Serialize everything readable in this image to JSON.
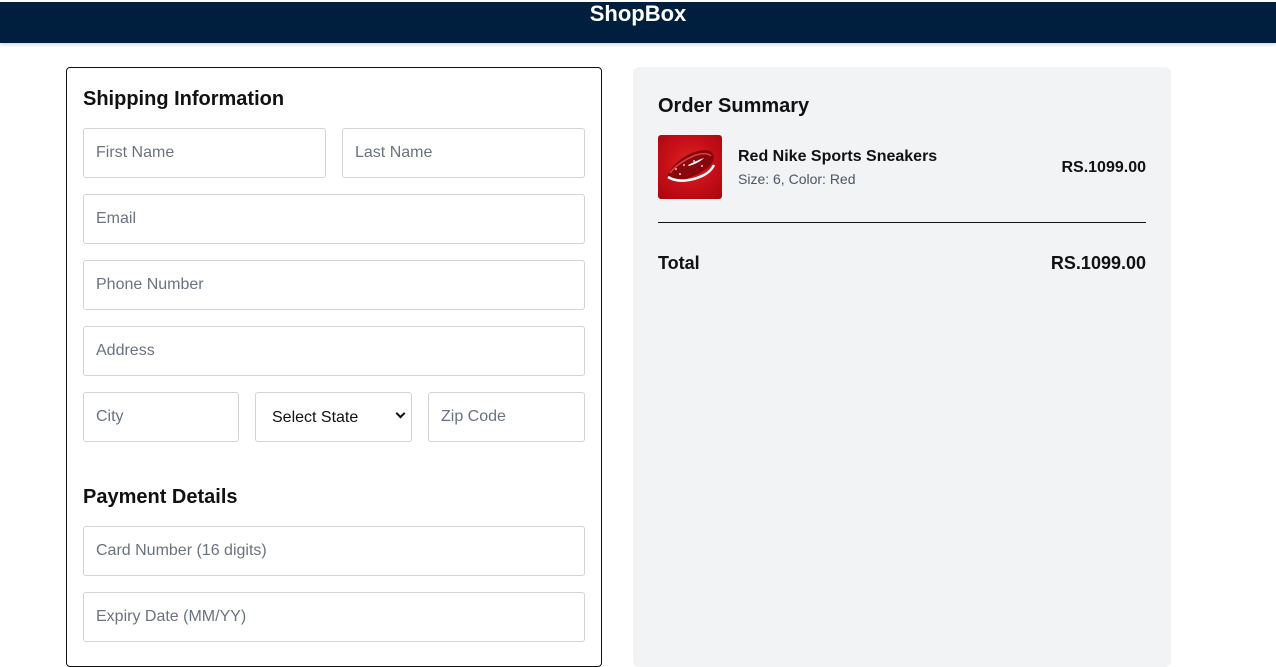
{
  "header": {
    "brand": "ShopBox"
  },
  "shipping": {
    "title": "Shipping Information",
    "first_name_placeholder": "First Name",
    "last_name_placeholder": "Last Name",
    "email_placeholder": "Email",
    "phone_placeholder": "Phone Number",
    "address_placeholder": "Address",
    "city_placeholder": "City",
    "state_selected": "Select State",
    "zip_placeholder": "Zip Code"
  },
  "payment": {
    "title": "Payment Details",
    "card_placeholder": "Card Number (16 digits)",
    "expiry_placeholder": "Expiry Date (MM/YY)"
  },
  "summary": {
    "title": "Order Summary",
    "item": {
      "name": "Red Nike Sports Sneakers",
      "meta": "Size: 6, Color: Red",
      "price": "RS.1099.00",
      "image_icon": "red-sneaker-image"
    },
    "total_label": "Total",
    "total_value": "RS.1099.00"
  },
  "colors": {
    "header_bg": "#001f3f",
    "summary_bg": "#f2f3f5",
    "product_red": "#c40e17"
  }
}
